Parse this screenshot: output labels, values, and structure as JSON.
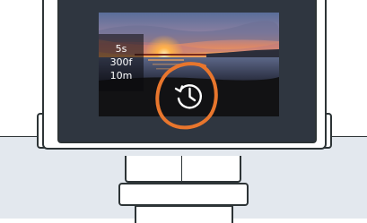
{
  "screen": {
    "interval": "5s",
    "frames": "300f",
    "duration": "10m"
  },
  "icons": {
    "timer": "clock-history-icon",
    "highlight": "highlight-ring-icon"
  },
  "colors": {
    "accent": "#e8762d",
    "bezel": "#2f3640",
    "outline": "#2d3436",
    "background_bottom": "#e3e8ee"
  }
}
